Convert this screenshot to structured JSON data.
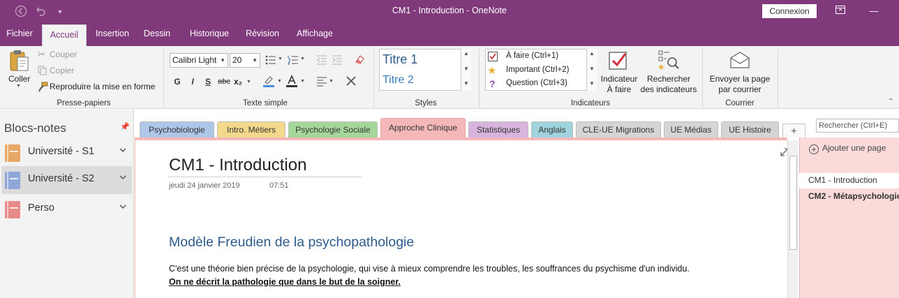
{
  "window": {
    "title": "CM1 - Introduction  -  OneNote",
    "sign_in": "Connexion"
  },
  "menu": {
    "tabs": [
      "Fichier",
      "Accueil",
      "Insertion",
      "Dessin",
      "Historique",
      "Révision",
      "Affichage"
    ],
    "active": "Accueil"
  },
  "ribbon": {
    "clipboard": {
      "paste": "Coller",
      "cut": "Couper",
      "copy": "Copier",
      "format_painter": "Reproduire la mise en forme",
      "group": "Presse-papiers"
    },
    "basic_text": {
      "font": "Calibri Light",
      "size": "20",
      "bold": "G",
      "italic": "I",
      "underline": "S",
      "strike": "abc",
      "subscript": "x₂",
      "group": "Texte simple"
    },
    "styles": {
      "items": [
        "Titre 1",
        "Titre 2"
      ],
      "group": "Styles"
    },
    "tags": {
      "items": [
        "À faire (Ctrl+1)",
        "Important (Ctrl+2)",
        "Question (Ctrl+3)"
      ],
      "todo_tag": "Indicateur\nÀ faire",
      "todo_tag_line1": "Indicateur",
      "todo_tag_line2": "À faire",
      "find_tags_line1": "Rechercher",
      "find_tags_line2": "des indicateurs",
      "group": "Indicateurs"
    },
    "email": {
      "label_line1": "Envoyer la page",
      "label_line2": "par courrier",
      "group": "Courrier"
    }
  },
  "notebooks": {
    "heading": "Blocs-notes",
    "items": [
      {
        "label": "Université - S1",
        "color": "#e8a765"
      },
      {
        "label": "Université - S2",
        "color": "#8ea6d8"
      },
      {
        "label": "Perso",
        "color": "#e88a8a"
      }
    ],
    "selected": "Université - S2"
  },
  "sections": [
    {
      "label": "Psychobiologie",
      "color": "#aec6e8"
    },
    {
      "label": "Intro. Métiers",
      "color": "#f3d98c"
    },
    {
      "label": "Psychologie Sociale",
      "color": "#a6d79a"
    },
    {
      "label": "Approche Clinique",
      "color": "#f5b8b8"
    },
    {
      "label": "Statistiques",
      "color": "#d8b5dc"
    },
    {
      "label": "Anglais",
      "color": "#9fd3de"
    },
    {
      "label": "CLE-UE Migrations",
      "color": "#d5d5d5"
    },
    {
      "label": "UE Médias",
      "color": "#d5d5d5"
    },
    {
      "label": "UE Histoire",
      "color": "#d5d5d5"
    }
  ],
  "add_section": "+",
  "search": {
    "placeholder": "Rechercher (Ctrl+E)"
  },
  "page": {
    "title": "CM1 - Introduction",
    "date": "jeudi 24 janvier 2019",
    "time": "07:51",
    "heading": "Modèle Freudien de la psychopathologie",
    "paragraph": "C'est une théorie bien précise de la psychologie, qui vise à mieux comprendre les troubles, les souffrances du psychisme d'un individu.",
    "emphasis": "On ne décrit la pathologie que dans le but de la soigner."
  },
  "pages_panel": {
    "add_page": "Ajouter une page",
    "pages": [
      "CM1 - Introduction",
      "CM2 - Métapsychologie"
    ]
  },
  "colors": {
    "brand": "#80397b",
    "active_section": "#f5b8b8",
    "heading_blue": "#2e5b8a"
  }
}
